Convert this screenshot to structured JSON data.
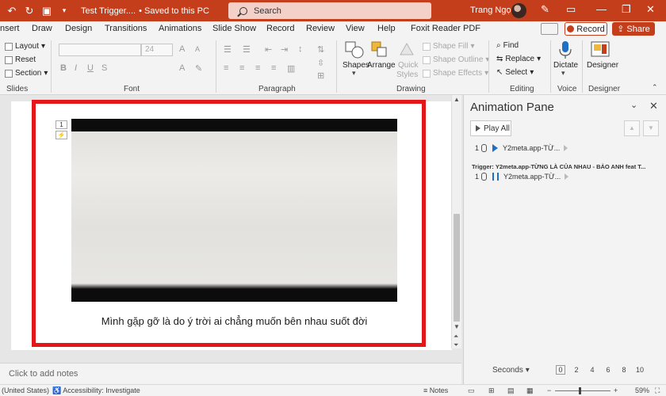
{
  "titlebar": {
    "doc_title": "Test Trigger....",
    "save_status": "• Saved to this PC",
    "search_placeholder": "Search",
    "user_name": "Trang Ngọc"
  },
  "ribbon_tabs": [
    "nsert",
    "Draw",
    "Design",
    "Transitions",
    "Animations",
    "Slide Show",
    "Record",
    "Review",
    "View",
    "Help",
    "Foxit Reader PDF"
  ],
  "record_label": "Record",
  "share_label": "Share",
  "ribbon": {
    "slides": {
      "layout": "Layout",
      "reset": "Reset",
      "section": "Section",
      "label": "Slides"
    },
    "font": {
      "size": "24",
      "label": "Font"
    },
    "paragraph": {
      "label": "Paragraph"
    },
    "drawing": {
      "shapes": "Shapes",
      "arrange": "Arrange",
      "quick": "Quick",
      "styles": "Styles",
      "shape_fill": "Shape Fill",
      "shape_outline": "Shape Outline",
      "shape_effects": "Shape Effects",
      "label": "Drawing"
    },
    "editing": {
      "find": "Find",
      "replace": "Replace",
      "select": "Select",
      "label": "Editing"
    },
    "voice": {
      "dictate": "Dictate",
      "label": "Voice"
    },
    "designer": {
      "button": "Designer",
      "label": "Designer"
    }
  },
  "slide": {
    "caption": "Mình gặp gỡ là do ý trời ai chẳng muốn bên nhau suốt đời",
    "anim_tag_1": "1"
  },
  "notes_placeholder": "Click to add notes",
  "pane": {
    "title": "Animation Pane",
    "play_all": "Play All",
    "items": [
      {
        "num": "1",
        "label": "Y2meta.app-TỪ..."
      },
      {
        "num": "1",
        "label": "Y2meta.app-TỪ..."
      }
    ],
    "trigger": "Trigger: Y2meta.app-TỪNG LÀ CỦA NHAU - BẢO ANH feat T...",
    "seconds": "Seconds",
    "timeline": [
      "0",
      "2",
      "4",
      "6",
      "8",
      "10"
    ]
  },
  "status": {
    "language": "(United States)",
    "accessibility": "Accessibility: Investigate",
    "notes": "Notes",
    "zoom": "59%"
  },
  "colors": {
    "accent": "#c43e1c",
    "highlight_frame": "#e3161a",
    "anim_blue": "#1f6fc5"
  }
}
